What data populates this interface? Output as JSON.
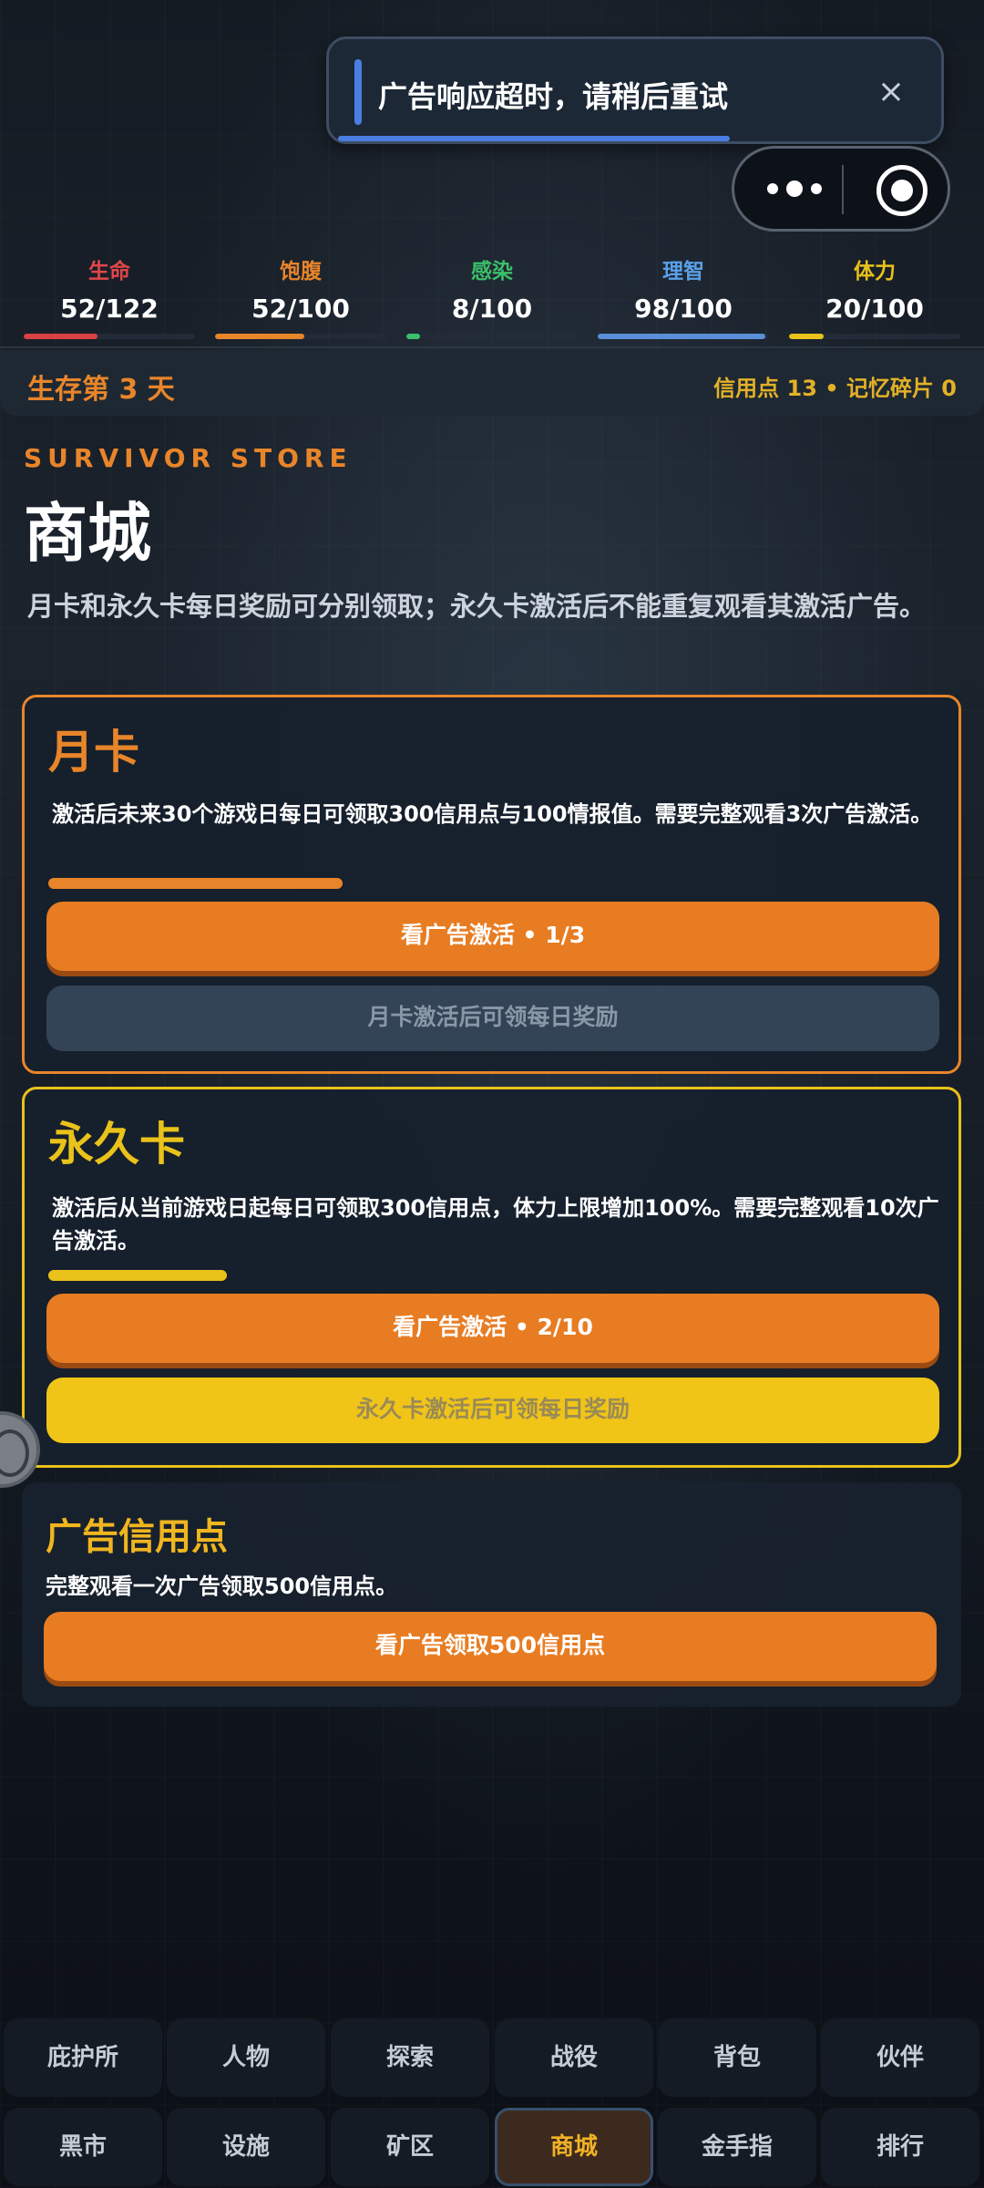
{
  "toast": {
    "message": "广告响应超时，请稍后重试",
    "close_icon": "×",
    "accent_color": "#4a7ee0"
  },
  "capsule": {
    "more_icon": "more-dots-icon",
    "target_icon": "target-icon"
  },
  "stats": [
    {
      "label": "生命",
      "value": "52/122",
      "ratio": 0.43,
      "color": "#e0464a",
      "fill": "#d94145"
    },
    {
      "label": "饱腹",
      "value": "52/100",
      "ratio": 0.52,
      "color": "#e8852a",
      "fill": "#e8852a"
    },
    {
      "label": "感染",
      "value": "8/100",
      "ratio": 0.08,
      "color": "#3bbf6a",
      "fill": "#3bbf6a"
    },
    {
      "label": "理智",
      "value": "98/100",
      "ratio": 0.98,
      "color": "#5aa0e8",
      "fill": "#5a8fd8"
    },
    {
      "label": "体力",
      "value": "20/100",
      "ratio": 0.2,
      "color": "#e9c21a",
      "fill": "#e9c21a"
    }
  ],
  "day": {
    "text": "生存第 3 天",
    "resources": "信用点 13 • 记忆碎片 0"
  },
  "store": {
    "subtitle": "SURVIVOR STORE",
    "title": "商城",
    "description": "月卡和永久卡每日奖励可分别领取；永久卡激活后不能重复观看其激活广告。"
  },
  "monthly_card": {
    "title": "月卡",
    "description": "激活后未来30个游戏日每日可领取300信用点与100情报值。需要完整观看3次广告激活。",
    "progress": 0.33,
    "activate_label": "看广告激活 • 1/3",
    "claim_label": "月卡激活后可领每日奖励",
    "color": "#e8852a"
  },
  "permanent_card": {
    "title": "永久卡",
    "description": "激活后从当前游戏日起每日可领取300信用点，体力上限增加100%。需要完整观看10次广告激活。",
    "progress": 0.2,
    "activate_label": "看广告激活 • 2/10",
    "claim_label": "永久卡激活后可领每日奖励",
    "color": "#e9c21a"
  },
  "ad_credits": {
    "title": "广告信用点",
    "description": "完整观看一次广告领取500信用点。",
    "button_label": "看广告领取500信用点",
    "color": "#f0b51f"
  },
  "nav": {
    "row1": [
      "庇护所",
      "人物",
      "探索",
      "战役",
      "背包",
      "伙伴"
    ],
    "row2": [
      "黑市",
      "设施",
      "矿区",
      "商城",
      "金手指",
      "排行"
    ],
    "active": "商城"
  }
}
